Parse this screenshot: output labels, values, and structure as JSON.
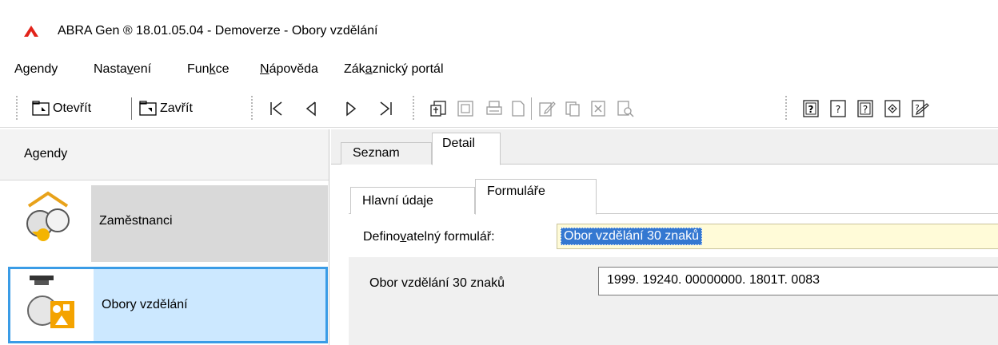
{
  "window": {
    "title": "ABRA Gen ® 18.01.05.04 - Demoverze - Obory vzdělání",
    "accent_color": "#3a9ce6"
  },
  "menu": {
    "items": [
      {
        "pre": "A",
        "ul": "g",
        "post": "endy",
        "full": "Agendy"
      },
      {
        "pre": "Nasta",
        "ul": "v",
        "post": "ení",
        "full": "Nastavení"
      },
      {
        "pre": "Fun",
        "ul": "k",
        "post": "ce",
        "full": "Funkce"
      },
      {
        "pre": "",
        "ul": "N",
        "post": "ápověda",
        "full": "Nápověda"
      },
      {
        "pre": "Zák",
        "ul": "a",
        "post": "znický portál",
        "full": "Zákaznický portál"
      }
    ]
  },
  "toolbar": {
    "open_label": "Otevřít",
    "close_label": "Zavřít",
    "nav_icons": [
      "first-record-icon",
      "previous-record-icon",
      "next-record-icon",
      "last-record-icon"
    ],
    "action_icons": [
      "import-icon",
      "export-icon",
      "print-icon",
      "new-document-icon",
      "edit-icon",
      "copy-icon",
      "delete-icon",
      "find-icon"
    ],
    "help_icons": [
      "help-icon",
      "context-help-icon",
      "help-topics-icon",
      "help-index-icon",
      "what-is-this-icon"
    ]
  },
  "agendas": {
    "header": "Agendy",
    "items": [
      {
        "label": "Zaměstnanci",
        "icon": "employees-icon",
        "selected": false
      },
      {
        "label": "Obory vzdělání",
        "icon": "education-fields-icon",
        "selected": true
      }
    ]
  },
  "tabs": {
    "main": [
      "Seznam",
      "Detail"
    ],
    "active_main": "Detail",
    "sub": [
      "Hlavní údaje",
      "Formuláře"
    ],
    "active_sub": "Formuláře"
  },
  "form": {
    "definable_label_pre": "Defino",
    "definable_label_ul": "v",
    "definable_label_post": "atelný formulář:",
    "definable_value": "Obor vzdělání 30 znaků",
    "field_label": "Obor vzdělání 30 znaků",
    "field_value": "1999. 19240. 00000000. 1801T. 0083"
  }
}
